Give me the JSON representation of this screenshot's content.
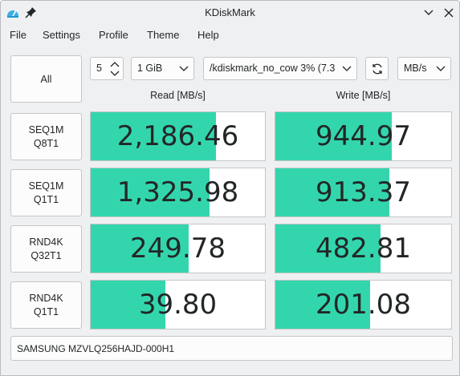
{
  "window": {
    "title": "KDiskMark"
  },
  "menu": [
    "File",
    "Settings",
    "Profile",
    "Theme",
    "Help"
  ],
  "toolbar": {
    "all_label": "All",
    "runs": "5",
    "size": "1 GiB",
    "target": "/kdiskmark_no_cow 3% (7.3",
    "unit": "MB/s"
  },
  "headers": {
    "read": "Read [MB/s]",
    "write": "Write [MB/s]"
  },
  "tests": [
    {
      "line1": "SEQ1M",
      "line2": "Q8T1",
      "read": "2,186.46",
      "write": "944.97",
      "read_fill": 0.72,
      "write_fill": 0.66
    },
    {
      "line1": "SEQ1M",
      "line2": "Q1T1",
      "read": "1,325.98",
      "write": "913.37",
      "read_fill": 0.68,
      "write_fill": 0.65
    },
    {
      "line1": "RND4K",
      "line2": "Q32T1",
      "read": "249.78",
      "write": "482.81",
      "read_fill": 0.56,
      "write_fill": 0.6
    },
    {
      "line1": "RND4K",
      "line2": "Q1T1",
      "read": "39.80",
      "write": "201.08",
      "read_fill": 0.43,
      "write_fill": 0.54
    }
  ],
  "device": "SAMSUNG MZVLQ256HAJD-000H1",
  "colors": {
    "bar": "#33d6ac",
    "background": "#eff0f1"
  }
}
